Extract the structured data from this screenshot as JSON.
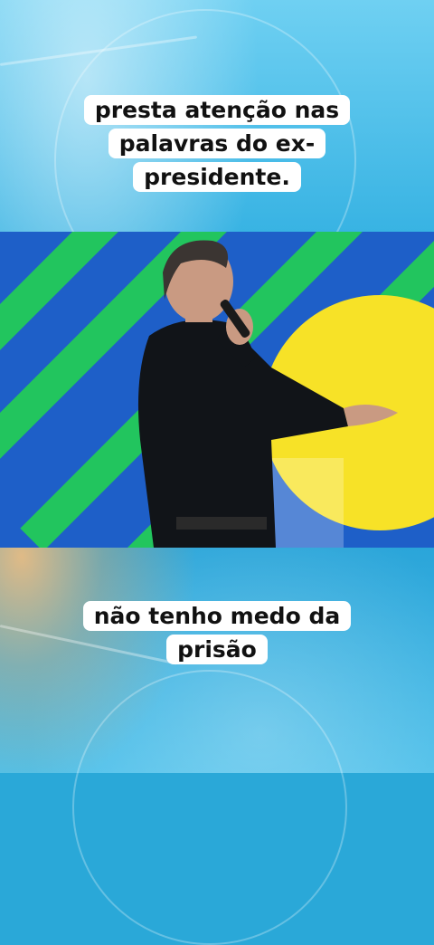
{
  "captions": {
    "top": [
      "presta atenção nas",
      "palavras do ex-",
      "presidente."
    ],
    "bottom": [
      "não tenho medo da",
      "prisão"
    ]
  },
  "colors": {
    "background": "#2aa8d8",
    "stage_blue": "#1e5fc8",
    "stripe_green": "#22c55e",
    "circle_yellow": "#f7e227",
    "caption_box": "#ffffff"
  },
  "video": {
    "subject": "man in black shirt speaking into microphone on stage"
  }
}
